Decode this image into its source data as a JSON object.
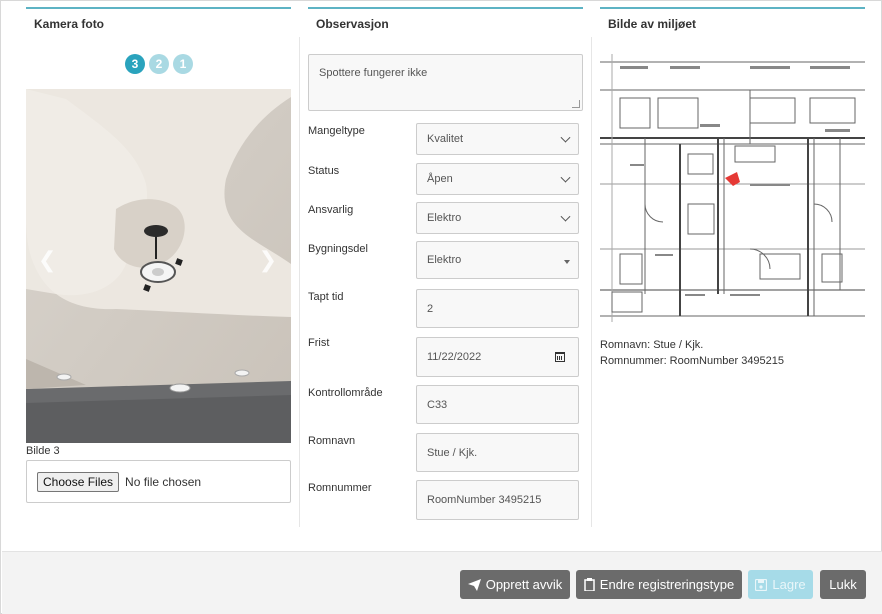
{
  "camera": {
    "title": "Kamera foto",
    "indicators": [
      "3",
      "2",
      "1"
    ],
    "caption": "Bilde 3",
    "file_button": "Choose Files",
    "file_status": "No file chosen"
  },
  "observation": {
    "title": "Observasjon",
    "text": "Spottere fungerer ikke",
    "fields": {
      "mangeltype": {
        "label": "Mangeltype",
        "value": "Kvalitet"
      },
      "status": {
        "label": "Status",
        "value": "Åpen"
      },
      "ansvarlig": {
        "label": "Ansvarlig",
        "value": "Elektro"
      },
      "bygningsdel": {
        "label": "Bygningsdel",
        "value": "Elektro"
      },
      "tapt_tid": {
        "label": "Tapt tid",
        "value": "2"
      },
      "frist": {
        "label": "Frist",
        "value": "11/22/2022"
      },
      "kontrollomrade": {
        "label": "Kontrollområde",
        "value": "C33"
      },
      "romnavn": {
        "label": "Romnavn",
        "value": "Stue / Kjk."
      },
      "romnummer": {
        "label": "Romnummer",
        "value": "RoomNumber 3495215"
      }
    }
  },
  "environment": {
    "title": "Bilde av miljøet",
    "room_name": "Romnavn: Stue / Kjk.",
    "room_number": "Romnummer: RoomNumber 3495215"
  },
  "footer": {
    "create": "Opprett avvik",
    "change_type": "Endre registreringstype",
    "save": "Lagre",
    "close": "Lukk"
  },
  "colors": {
    "accent": "#2aa3bd",
    "button": "#6b6b6b",
    "marker": "#e53935"
  }
}
